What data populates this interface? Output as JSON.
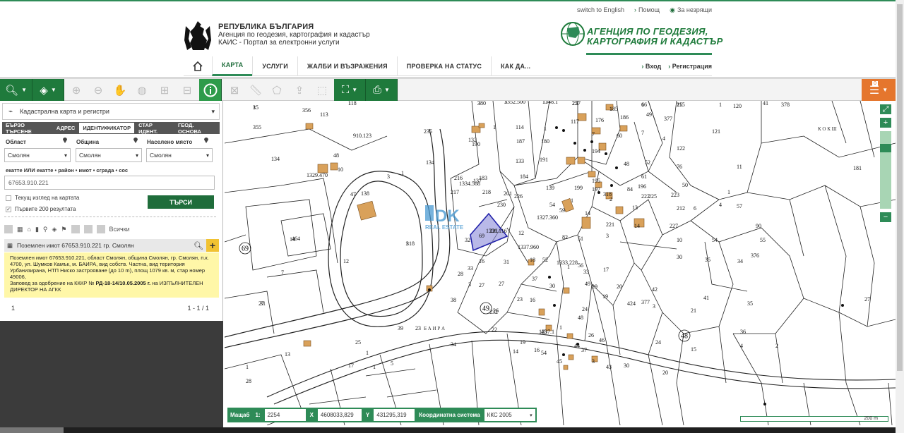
{
  "header": {
    "toplinks": [
      "switch to English",
      "Помощ",
      "За незрящи"
    ],
    "republic": "РЕПУБЛИКА БЪЛГАРИЯ",
    "agency_line": "Агенция по геодезия, картография и кадастър",
    "portal_line": "КАИС - Портал за електронни услуги",
    "logo_text_1": "АГЕНЦИЯ ПО ГЕОДЕЗИЯ,",
    "logo_text_2": "КАРТОГРАФИЯ И КАДАСТЪР"
  },
  "nav": {
    "items": [
      "КАРТА",
      "УСЛУГИ",
      "ЖАЛБИ И ВЪЗРАЖЕНИЯ",
      "ПРОВЕРКА НА СТАТУС",
      "КАК ДА..."
    ],
    "login": "Вход",
    "register": "Регистрация"
  },
  "toolbar": {
    "notify_count": "0"
  },
  "panel": {
    "layer": "Кадастрална карта и регистри",
    "tabs": [
      "БЪРЗО ТЪРСЕНЕ",
      "АДРЕС",
      "ИДЕНТИФИКАТОР",
      "СТАР ИДЕНТ.",
      "ГЕОД. ОСНОВА"
    ],
    "oblast_label": "Област",
    "obshtina_label": "Община",
    "naseleno_label": "Населено място",
    "oblast": "Смолян",
    "obshtina": "Смолян",
    "naseleno": "Смолян",
    "search_label": "екатте ИЛИ екатте • район • имот • сграда • сос",
    "search_value": "67653.910.221",
    "chk_current": "Текущ изглед на картата",
    "chk_first": "Първите 200 резултата",
    "search_button": "ТЪРСИ",
    "all_label": "Всички",
    "result_title": "Поземлен имот 67653.910.221 гр. Смолян",
    "result_body": "Поземлен имот 67653.910.221, област Смолян, община Смолян, гр. Смолян, п.к. 4700, ул. Шумков Камък, м. БАИРА, вид собств. Частна, вид територия Урбанизирана, НТП Ниско застрояване (до 10 m), площ 1079 кв. м, стар номер 49006,",
    "result_body2_pre": "Заповед за одобрение на КККР № ",
    "result_body2_bold": "РД-18-14/10.05.2005 г.",
    "result_body2_post": " на ИЗПЪЛНИТЕЛЕН ДИРЕКТОР НА АГКК",
    "page": "1",
    "count": "1 - 1 / 1"
  },
  "map": {
    "watermark": "DK",
    "watermark_sub": "REAL ESTATE",
    "labels": [
      "15",
      "118",
      "380",
      "1352.500",
      "1348.1",
      "227",
      "185",
      "6",
      "115",
      "1",
      "120",
      "41",
      "378",
      "355",
      "356",
      "113",
      "1",
      "114",
      "1",
      "117",
      "176",
      "186",
      "49",
      "377",
      "121",
      "910.123",
      "235",
      "132",
      "190",
      "187",
      "180",
      "7",
      "60",
      "7",
      "4",
      "122",
      "134",
      "134",
      "1329.470",
      "10",
      "48",
      "133",
      "191",
      "194",
      "48",
      "52",
      "76",
      "11",
      "1",
      "3",
      "217",
      "218",
      "216",
      "1334.568",
      "137",
      "184",
      "195",
      "196",
      "61",
      "50",
      "47",
      "138",
      "139",
      "199",
      "197",
      "84",
      "223",
      "1",
      "181",
      "183",
      "201",
      "1",
      "2",
      "222",
      "225",
      "230",
      "226",
      "1327.360",
      "54",
      "59",
      "82",
      "14",
      "318",
      "221",
      "13",
      "212",
      "6",
      "4",
      "57",
      "90",
      "464",
      "1",
      "1336.116",
      "12",
      "3",
      "14",
      "227",
      "10",
      "54",
      "55",
      "32",
      "69",
      "16",
      "31",
      "18",
      "52",
      "1333.228",
      "56",
      "33",
      "17",
      "30",
      "35",
      "34",
      "28",
      "1",
      "1337.960",
      "51",
      "376",
      "7",
      "27",
      "3",
      "27",
      "37",
      "30",
      "49",
      "29",
      "20",
      "377",
      "3",
      "21",
      "35",
      "31",
      "38",
      "232",
      "23",
      "16",
      "19",
      "24",
      "424",
      "42",
      "41",
      "36",
      "27",
      "39",
      "23",
      "22",
      "1337.1",
      "1",
      "48",
      "26",
      "46",
      "26",
      "25",
      "34",
      "14",
      "16",
      "45",
      "44",
      "43",
      "24",
      "15",
      "13",
      "17",
      "1",
      "5",
      "19",
      "54",
      "45",
      "37",
      "3",
      "30",
      "20",
      "4",
      "2",
      "28",
      "1",
      "1",
      "3",
      "1",
      "3",
      "3",
      "17",
      "25",
      "1",
      "16",
      "25"
    ],
    "circle_labels": [
      "69",
      "49",
      "48"
    ],
    "zoom_in": "+",
    "zoom_out": "−"
  },
  "status": {
    "scale_label": "Мащаб",
    "scale_prefix": "1:",
    "scale_value": "2254",
    "x_label": "X",
    "x_value": "4608033,829",
    "y_label": "Y",
    "y_value": "431295,319",
    "coord_label": "Координатна система",
    "coord_value": "ККС 2005",
    "scale_dist": "200 m"
  }
}
